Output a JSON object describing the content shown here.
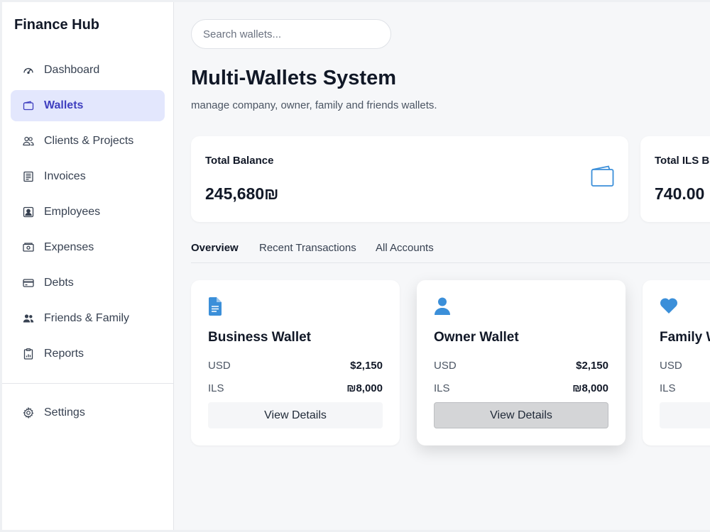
{
  "app": {
    "brand": "Finance Hub"
  },
  "sidebar": {
    "items": [
      {
        "label": "Dashboard",
        "icon": "gauge-icon"
      },
      {
        "label": "Wallets",
        "icon": "wallet-icon",
        "active": true
      },
      {
        "label": "Clients & Projects",
        "icon": "users-icon"
      },
      {
        "label": "Invoices",
        "icon": "invoice-icon"
      },
      {
        "label": "Employees",
        "icon": "employee-icon"
      },
      {
        "label": "Expenses",
        "icon": "cash-icon"
      },
      {
        "label": "Debts",
        "icon": "credit-card-icon"
      },
      {
        "label": "Friends & Family",
        "icon": "people-icon"
      },
      {
        "label": "Reports",
        "icon": "report-icon"
      }
    ],
    "settings": {
      "label": "Settings",
      "icon": "gear-icon"
    }
  },
  "search": {
    "placeholder": "Search wallets..."
  },
  "page": {
    "title": "Multi-Wallets System",
    "subtitle": "manage company, owner, family and friends wallets."
  },
  "stats": [
    {
      "label": "Total Balance",
      "value": "245,680₪",
      "icon": "wallet-icon"
    },
    {
      "label": "Total ILS B",
      "value": "740.00"
    }
  ],
  "tabs": [
    {
      "label": "Overview",
      "active": true
    },
    {
      "label": "Recent Transactions"
    },
    {
      "label": "All Accounts"
    }
  ],
  "wallets": [
    {
      "title": "Business Wallet",
      "icon": "document-icon",
      "usd_label": "USD",
      "usd": "$2,150",
      "ils_label": "ILS",
      "ils": "₪8,000",
      "button": "View Details"
    },
    {
      "title": "Owner Wallet",
      "icon": "user-icon",
      "usd_label": "USD",
      "usd": "$2,150",
      "ils_label": "ILS",
      "ils": "₪8,000",
      "button": "View Details"
    },
    {
      "title": "Family W",
      "icon": "heart-icon",
      "usd_label": "USD",
      "ils_label": "ILS"
    }
  ],
  "colors": {
    "accent": "#3f3fbf",
    "active_nav_bg": "#e3e7fd",
    "icon_blue": "#3b8fd9"
  }
}
